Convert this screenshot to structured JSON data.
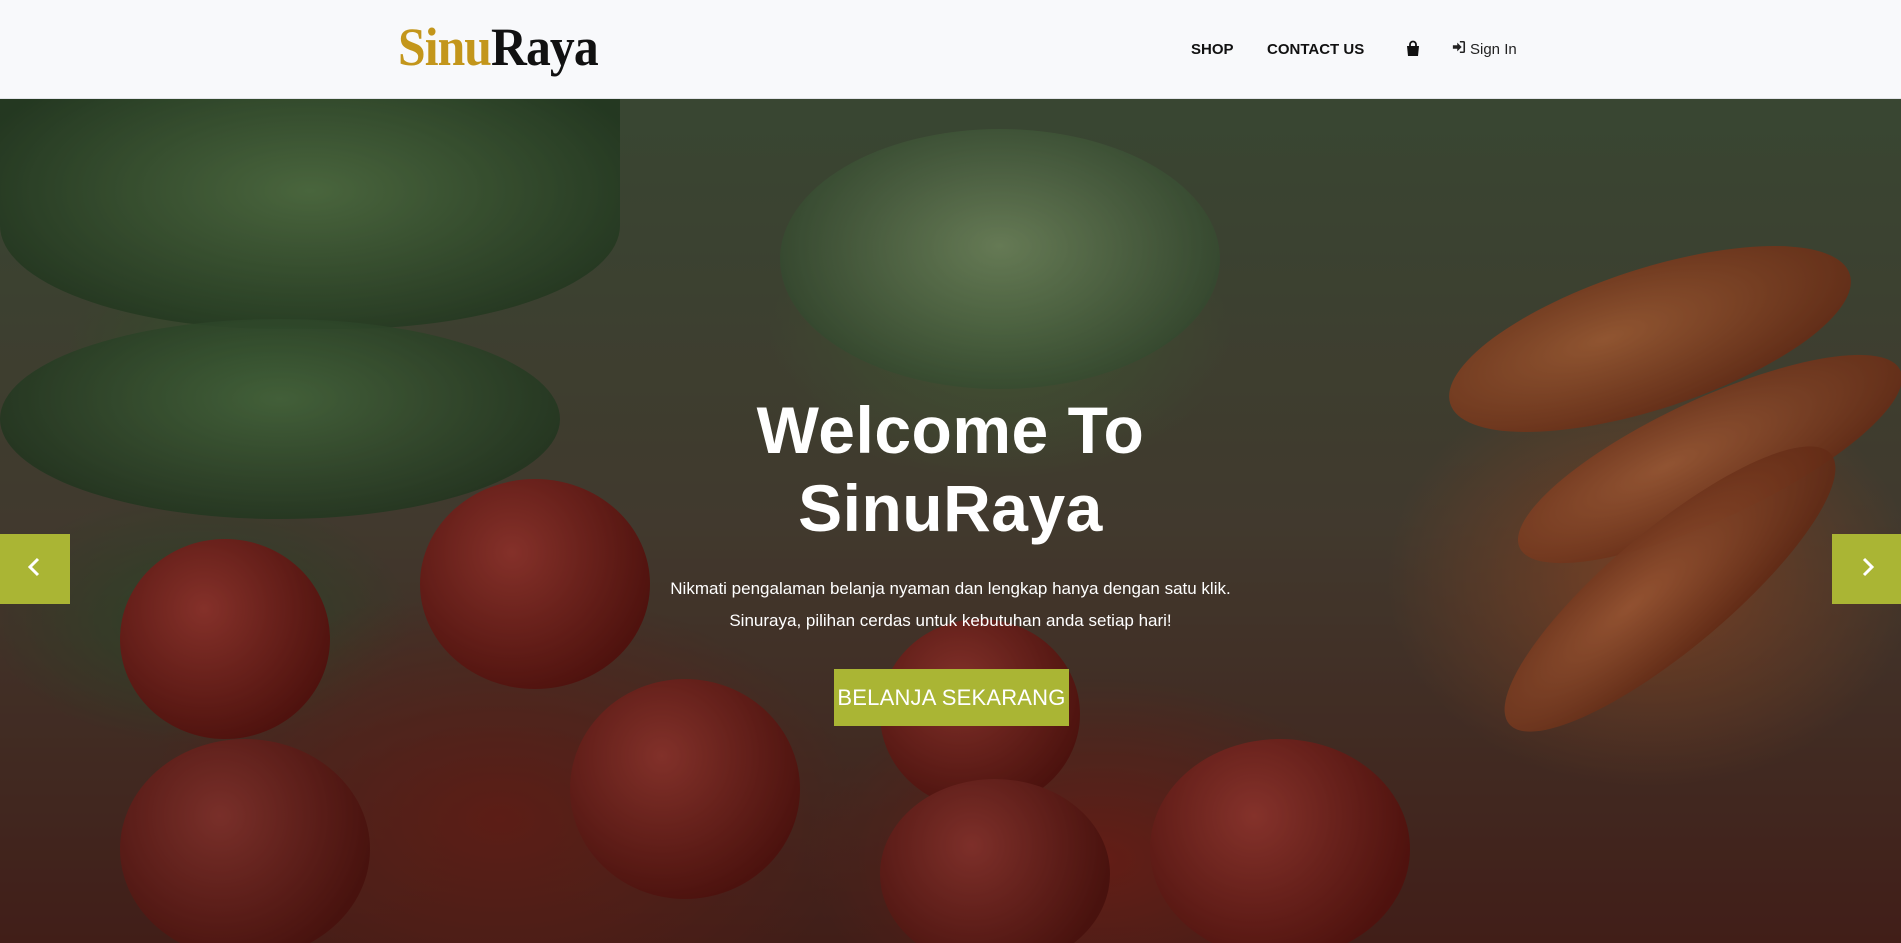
{
  "header": {
    "logo": {
      "part1": "Sinu",
      "part2": "Raya"
    },
    "nav": [
      {
        "label": "SHOP"
      },
      {
        "label": "CONTACT US"
      }
    ],
    "cart_icon": "shopping-bag-icon",
    "signin": {
      "icon": "sign-in-icon",
      "label": "Sign In"
    }
  },
  "hero": {
    "title_line1": "Welcome To",
    "title_line2": "SinuRaya",
    "subtitle_line1": "Nikmati pengalaman belanja nyaman dan lengkap hanya dengan satu klik.",
    "subtitle_line2": "Sinuraya, pilihan cerdas untuk kebutuhan anda setiap hari!",
    "cta_label": "BELANJA SEKARANG",
    "prev_icon": "chevron-left-icon",
    "next_icon": "chevron-right-icon"
  },
  "colors": {
    "accent": "#aab534",
    "logo_gold": "#c3961b",
    "logo_dark": "#111111",
    "navbar_bg": "#f8f9fb"
  }
}
